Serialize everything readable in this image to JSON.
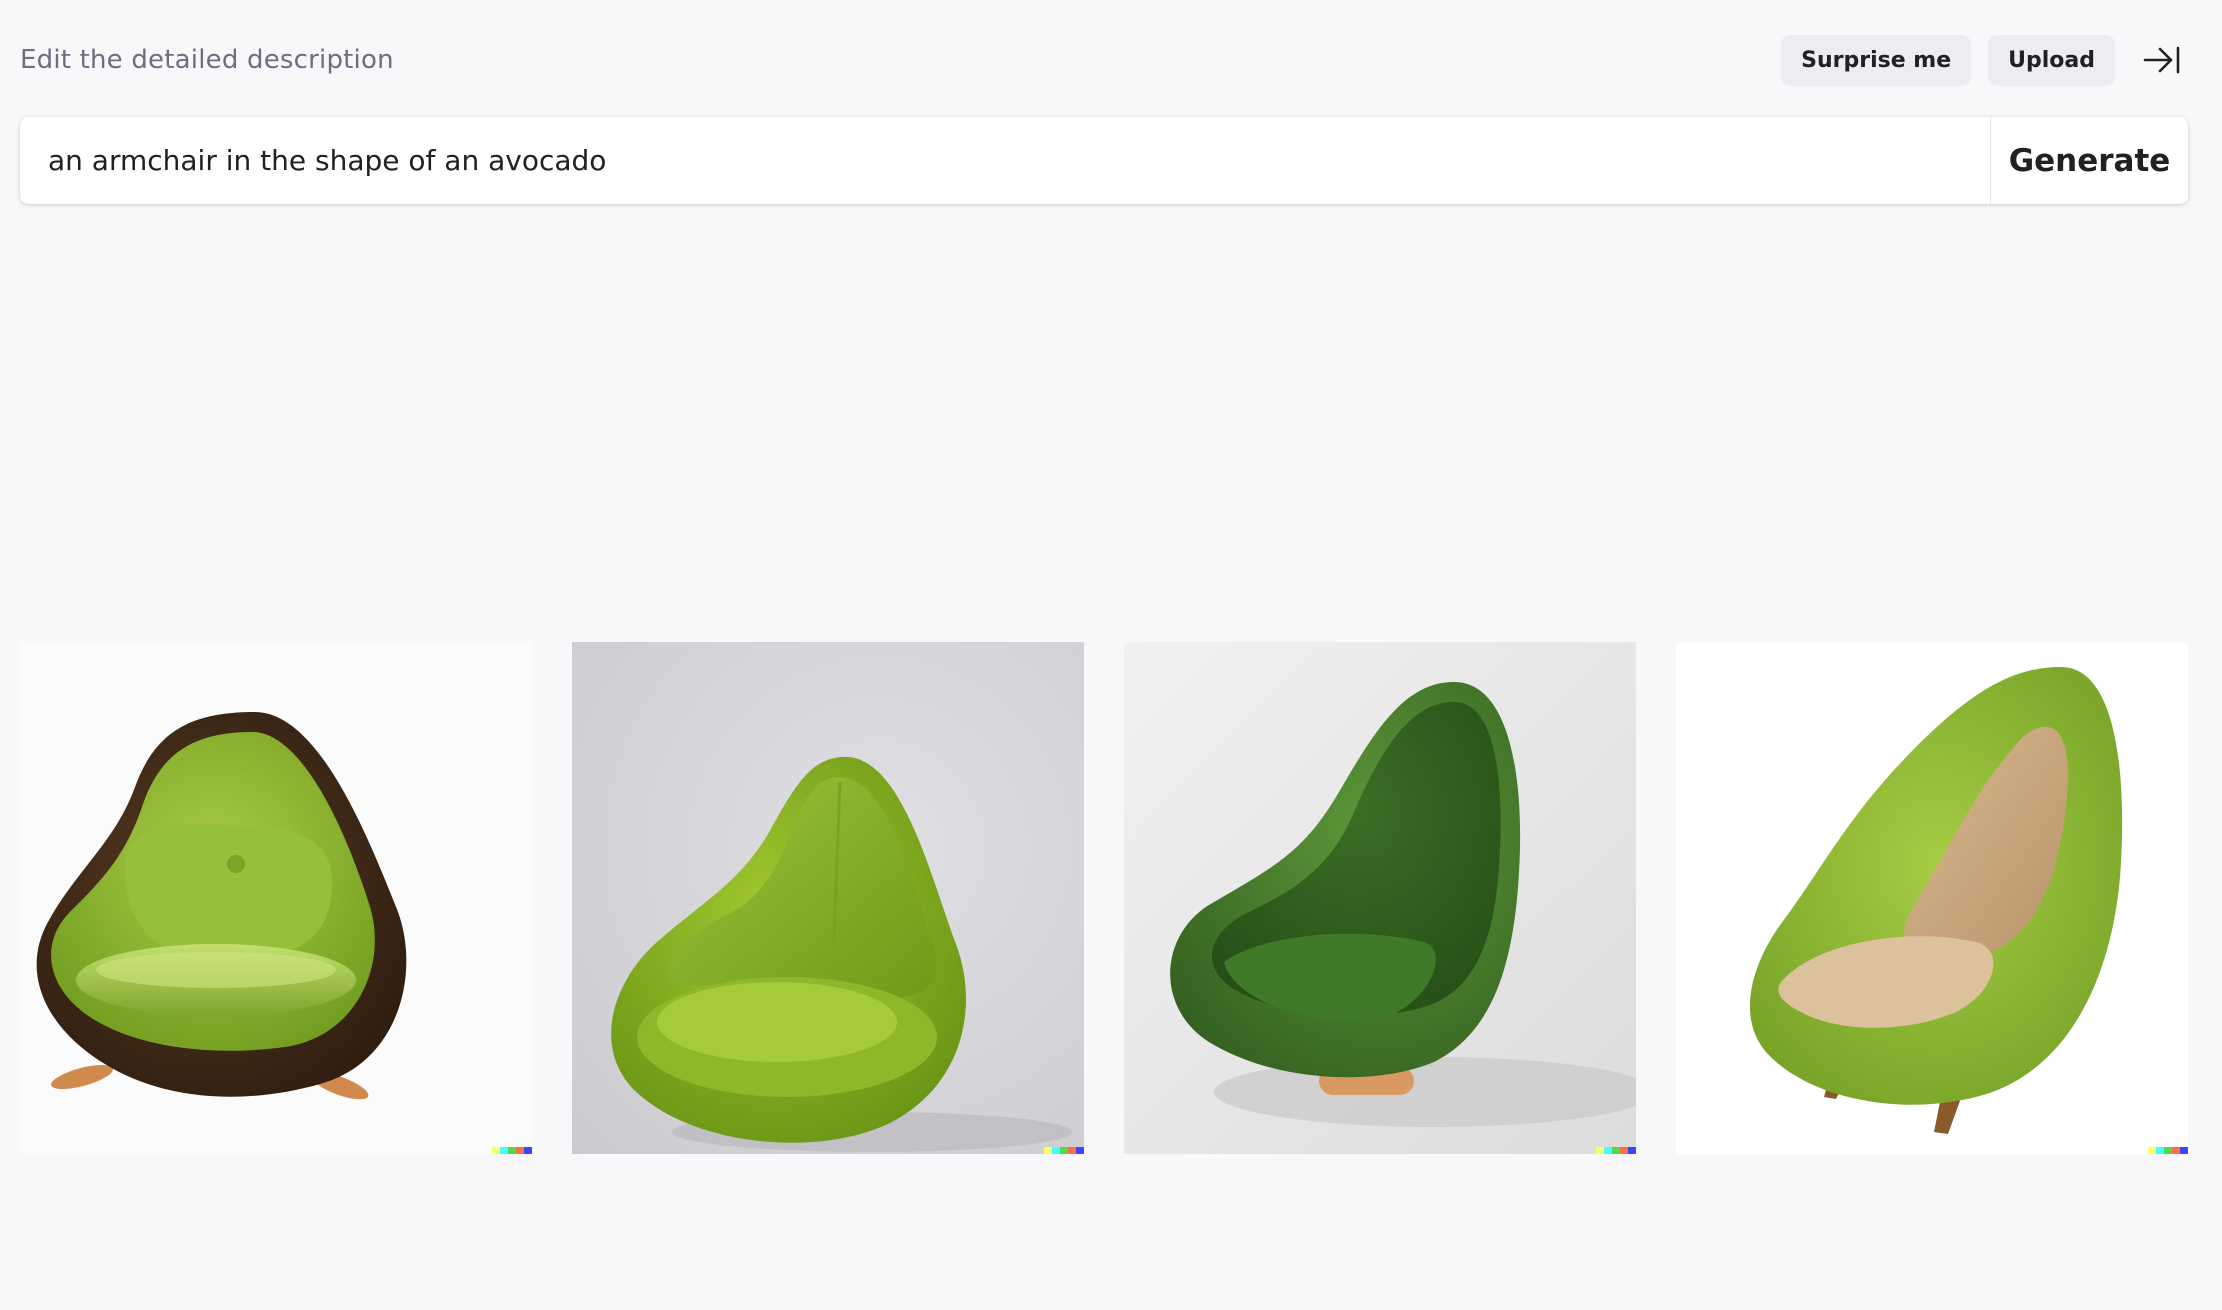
{
  "header": {
    "hint": "Edit the detailed description",
    "surprise_label": "Surprise me",
    "upload_label": "Upload",
    "collapse_icon": "arrow-right-to-line-icon"
  },
  "prompt": {
    "value": "an armchair in the shape of an avocado",
    "generate_label": "Generate"
  },
  "results": [
    {
      "subject": "avocado armchair with brown shell and green seat",
      "background": "#fbfbfb"
    },
    {
      "subject": "glossy lime green leather teardrop armchair",
      "background": "#d6d6da"
    },
    {
      "subject": "dark green teardrop armchair with pillow",
      "background": "#eaeaea"
    },
    {
      "subject": "green shell armchair with beige cushion",
      "background": "#ffffff"
    }
  ],
  "colors": {
    "page_bg": "#f8f8fa",
    "pill_bg": "#ececf1",
    "text_primary": "#202123",
    "text_secondary": "#6e6e80",
    "signature": [
      "#ffff66",
      "#42ffff",
      "#51da4c",
      "#ff6e3c",
      "#3c46ff"
    ]
  }
}
